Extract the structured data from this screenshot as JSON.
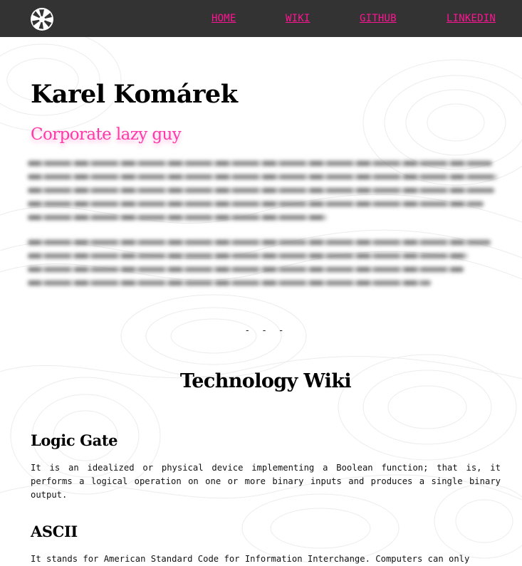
{
  "nav": {
    "logo_icon": "aperture-icon",
    "links": [
      "HOME",
      "WIKI",
      "GITHUB",
      "LINKEDIN"
    ],
    "link_color": "#ff1493",
    "bar_color": "#333333"
  },
  "profile": {
    "name": "Karel Komárek",
    "tagline": "Corporate lazy guy",
    "tagline_color": "#ff3aa8"
  },
  "divider": "- - -",
  "wiki": {
    "title": "Technology Wiki",
    "entries": [
      {
        "heading": "Logic Gate",
        "text": "It is an idealized or physical device implementing a Boolean function; that is, it performs a logical operation on one or more binary inputs and produces a single binary output."
      },
      {
        "heading": "ASCII",
        "text": "It stands for American Standard Code for Information Interchange. Computers can only"
      }
    ]
  }
}
